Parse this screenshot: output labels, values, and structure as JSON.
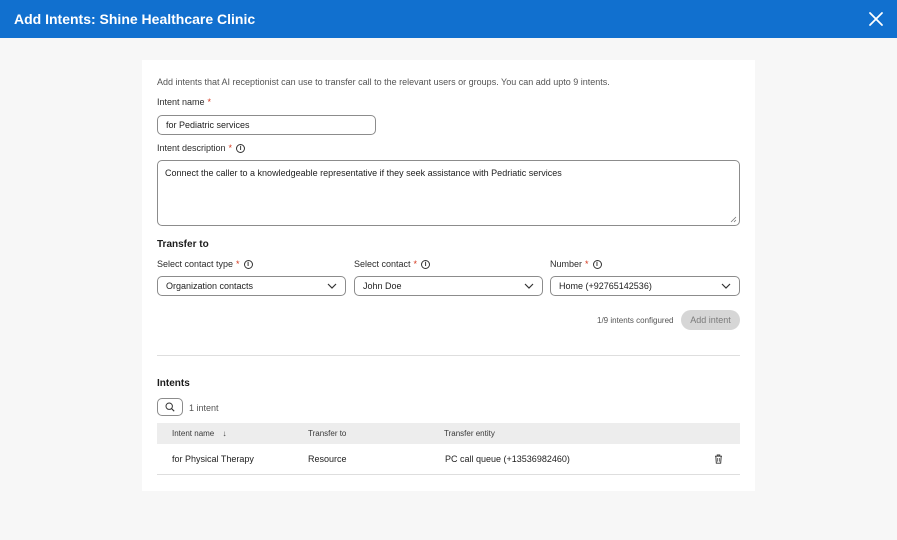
{
  "header": {
    "title": "Add Intents: Shine Healthcare Clinic"
  },
  "form": {
    "help_text": "Add intents that AI receptionist can use to transfer call to the relevant users or groups. You can add upto 9 intents.",
    "intent_name_label": "Intent name",
    "intent_name_value": "for Pediatric services",
    "intent_description_label": "Intent description",
    "intent_description_value": "Connect the caller to a knowledgeable representative if they seek assistance with Pedriatic services",
    "required_mark": "*",
    "info_glyph": "i"
  },
  "transfer": {
    "title": "Transfer to",
    "contact_type_label": "Select contact type",
    "contact_type_value": "Organization contacts",
    "contact_label": "Select contact",
    "contact_value": "John Doe",
    "number_label": "Number",
    "number_value": "Home (+92765142536)",
    "configured_count": "1/9 intents configured",
    "add_button_label": "Add intent"
  },
  "intents": {
    "title": "Intents",
    "count_text": "1 intent",
    "columns": [
      "Intent name",
      "Transfer to",
      "Transfer entity"
    ],
    "sort_indicator": "↓",
    "rows": [
      {
        "name": "for Physical Therapy",
        "transfer_to": "Resource",
        "entity": "PC call queue (+13536982460)"
      }
    ]
  },
  "colors": {
    "header_bg": "#1170cf",
    "required": "#d4371c"
  },
  "icons": {
    "close": "close-icon",
    "chevron": "chevron-down-icon",
    "search": "search-icon",
    "delete": "trash-icon",
    "info": "info-icon"
  }
}
